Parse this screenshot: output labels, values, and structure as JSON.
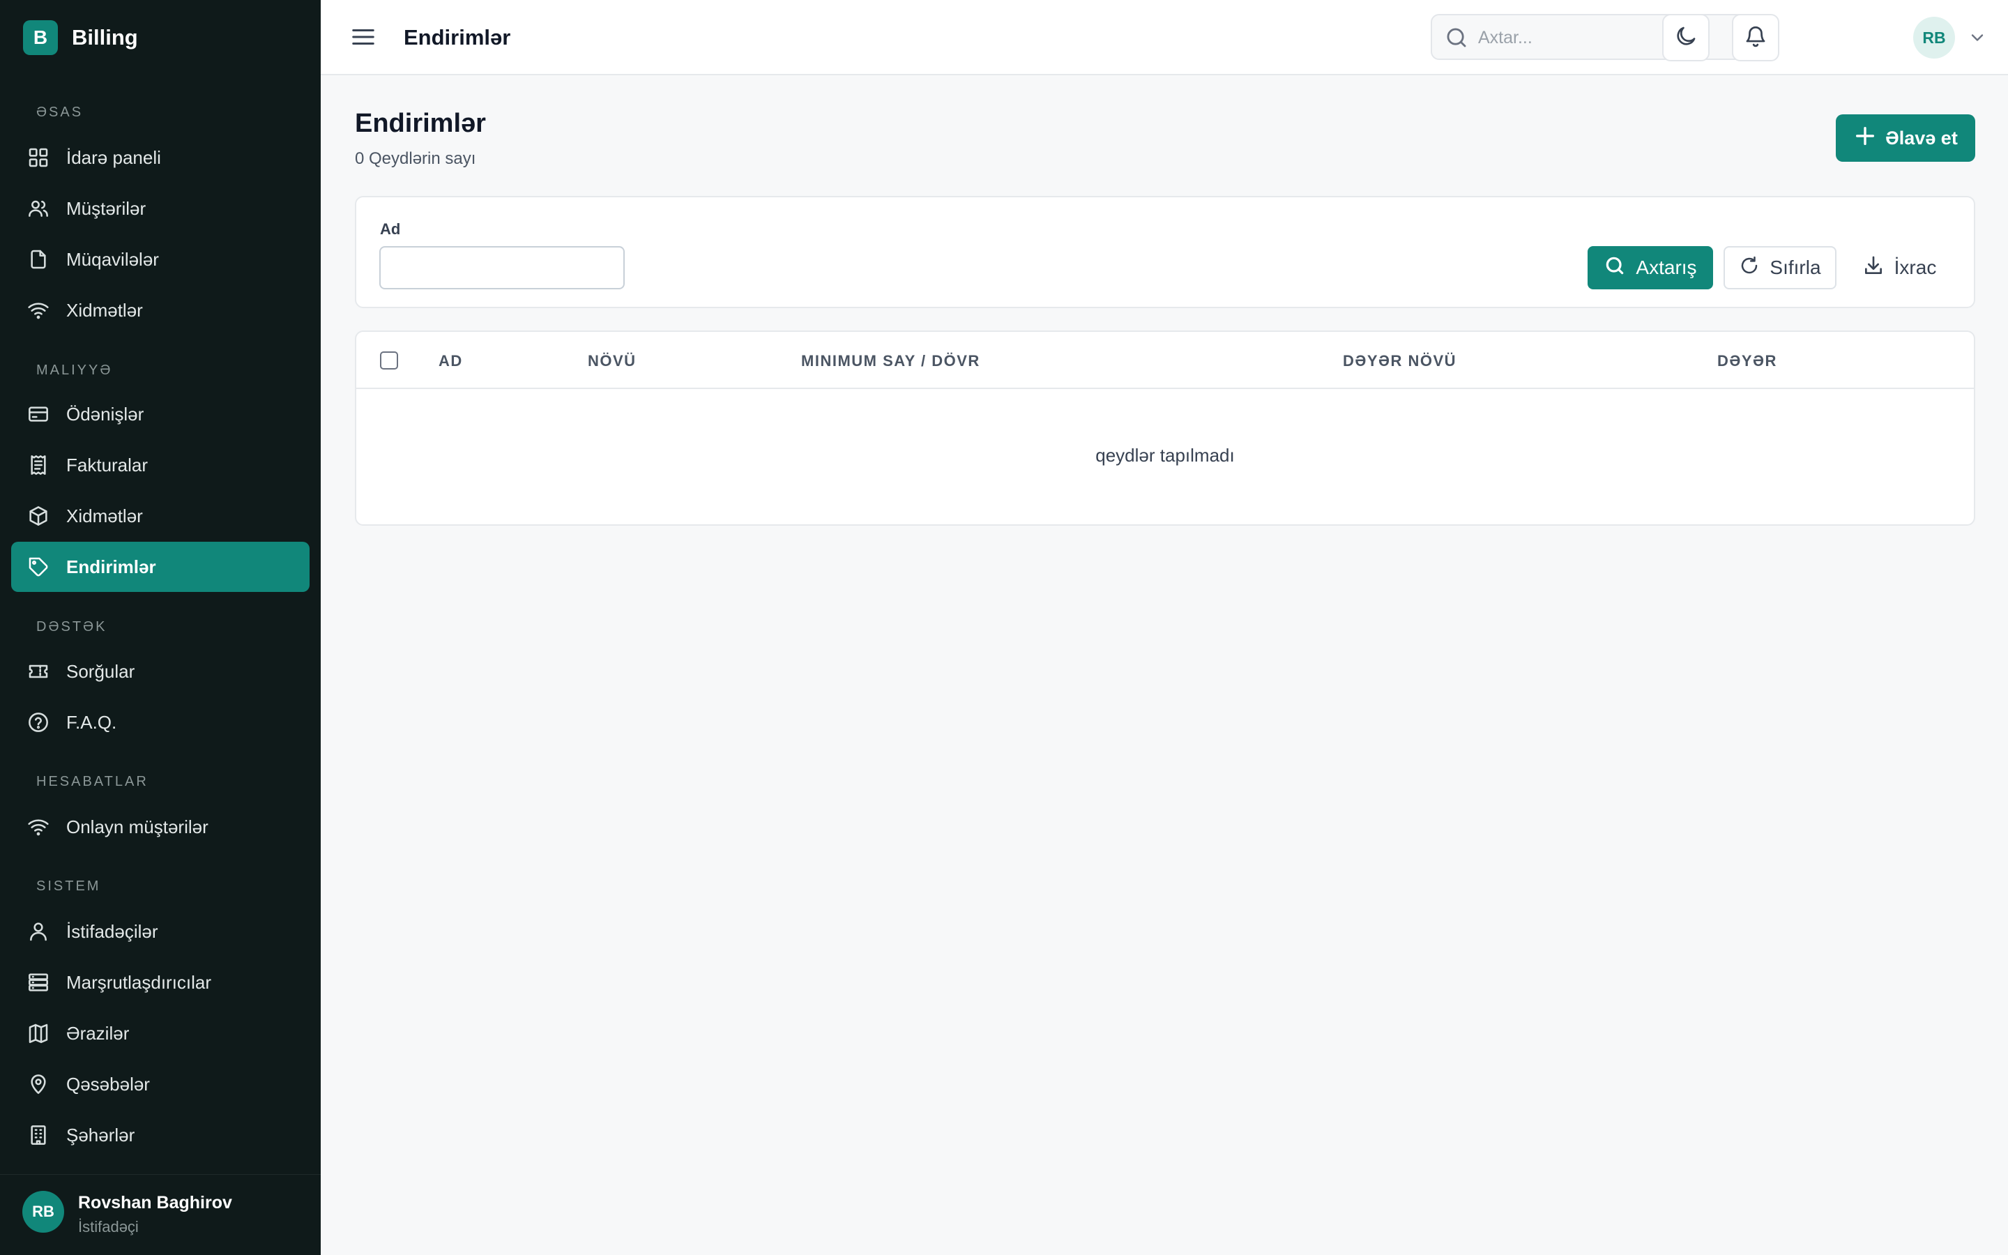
{
  "brand": {
    "badge": "B",
    "name": "Billing"
  },
  "sidebar": {
    "sections": [
      {
        "title": "Əsas",
        "items": [
          {
            "label": "İdarə paneli",
            "icon": "grid-icon"
          },
          {
            "label": "Müştərilər",
            "icon": "users-icon"
          },
          {
            "label": "Müqavilələr",
            "icon": "file-icon"
          },
          {
            "label": "Xidmətlər",
            "icon": "wifi-icon"
          }
        ]
      },
      {
        "title": "Maliyyə",
        "items": [
          {
            "label": "Ödənişlər",
            "icon": "credit-card-icon"
          },
          {
            "label": "Fakturalar",
            "icon": "receipt-icon"
          },
          {
            "label": "Xidmətlər",
            "icon": "box-icon"
          },
          {
            "label": "Endirimlər",
            "icon": "tag-icon",
            "active": true
          }
        ]
      },
      {
        "title": "Dəstək",
        "items": [
          {
            "label": "Sorğular",
            "icon": "ticket-icon"
          },
          {
            "label": "F.A.Q.",
            "icon": "help-circle-icon"
          }
        ]
      },
      {
        "title": "Hesabatlar",
        "items": [
          {
            "label": "Onlayn müştərilər",
            "icon": "wifi-icon"
          }
        ]
      },
      {
        "title": "Sistem",
        "items": [
          {
            "label": "İstifadəçilər",
            "icon": "user-icon"
          },
          {
            "label": "Marşrutlaşdırıcılar",
            "icon": "server-icon"
          },
          {
            "label": "Ərazilər",
            "icon": "map-icon"
          },
          {
            "label": "Qəsəbələr",
            "icon": "map-pin-icon"
          },
          {
            "label": "Şəhərlər",
            "icon": "building-icon"
          }
        ]
      }
    ]
  },
  "user": {
    "initials": "RB",
    "name": "Rovshan Baghirov",
    "role": "İstifadəçi"
  },
  "topbar": {
    "title": "Endirimlər",
    "search_placeholder": "Axtar...",
    "avatar_initials": "RB"
  },
  "page": {
    "title": "Endirimlər",
    "subtitle": "0 Qeydlərin sayı",
    "add_label": "Əlavə et"
  },
  "filter": {
    "name_label": "Ad",
    "name_value": "",
    "search_label": "Axtarış",
    "reset_label": "Sıfırla",
    "export_label": "İxrac"
  },
  "table": {
    "columns": [
      "AD",
      "NÖVÜ",
      "MINIMUM SAY / DÖVR",
      "DƏYƏR NÖVÜ",
      "DƏYƏR"
    ],
    "empty_text": "qeydlər tapılmadı"
  },
  "colors": {
    "accent": "#11877a",
    "sidebar_bg": "#0f1a1a",
    "page_bg": "#f7f8f9"
  }
}
